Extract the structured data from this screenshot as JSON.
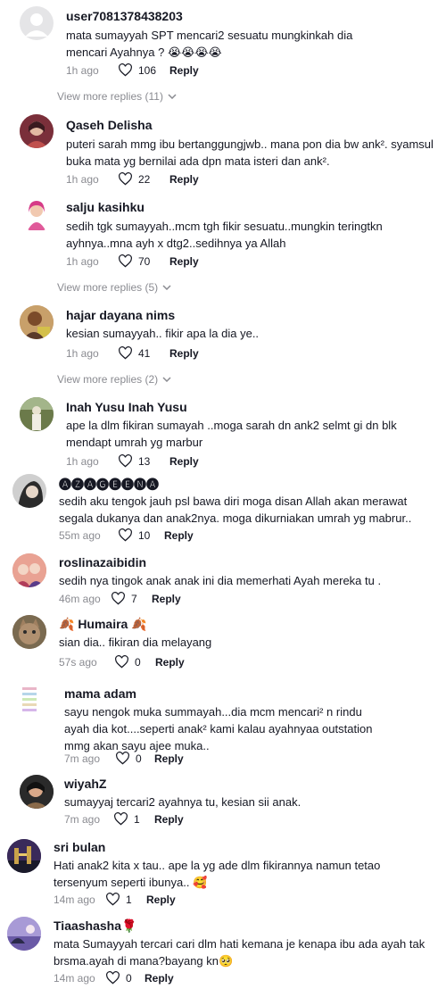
{
  "comments": [
    {
      "name": "user7081378438203",
      "text": "mata sumayyah SPT mencari2 sesuatu mungkinkah dia mencari Ayahnya ? 😭😭😭😭",
      "time": "1h ago",
      "likes": "106",
      "reply": "Reply",
      "more": "View more replies (11)"
    },
    {
      "name": "Qaseh Delisha",
      "text": "puteri sarah mmg ibu bertanggungjwb.. mana pon dia bw ank². syamsul buka mata yg bernilai ada dpn mata isteri dan ank².",
      "time": "1h ago",
      "likes": "22",
      "reply": "Reply"
    },
    {
      "name": "salju kasihku",
      "text": "sedih tgk sumayyah..mcm tgh fikir sesuatu..mungkin teringtkn ayhnya..mna ayh x dtg2..sedihnya ya Allah",
      "time": "1h ago",
      "likes": "70",
      "reply": "Reply",
      "more": "View more replies (5)"
    },
    {
      "name": "hajar dayana nims",
      "text": "kesian sumayyah.. fikir apa la dia ye..",
      "time": "1h ago",
      "likes": "41",
      "reply": "Reply",
      "more": "View more replies (2)"
    },
    {
      "name": "Inah Yusu Inah Yusu",
      "text": "ape la dlm fikiran sumayah ..moga sarah dn ank2 selmt gi dn blk mendapt umrah yg marbur",
      "time": "1h ago",
      "likes": "13",
      "reply": "Reply"
    },
    {
      "name": "🅐🅩🅐🅖🅔🅔🅝🅐",
      "text": "sedih aku tengok jauh psl bawa diri moga disan Allah akan merawat segala dukanya dan anak2nya. moga dikurniakan umrah yg mabrur..",
      "time": "55m ago",
      "likes": "10",
      "reply": "Reply"
    },
    {
      "name": "roslinazaibidin",
      "text": "sedih nya tingok anak anak ini dia memerhati Ayah mereka tu .",
      "time": "46m ago",
      "likes": "7",
      "reply": "Reply"
    },
    {
      "name": "🍂 Humaira 🍂",
      "text": "sian dia.. fikiran dia melayang",
      "time": "57s ago",
      "likes": "0",
      "reply": "Reply"
    },
    {
      "name": "mama adam",
      "text": "sayu nengok muka summayah...dia mcm mencari² n rindu ayah dia kot....seperti anak² kami kalau ayahnyaa outstation mmg akan sayu ajee muka..",
      "time": "7m ago",
      "likes": "0",
      "reply": "Reply"
    },
    {
      "name": "wiyahZ",
      "text": "sumayyaj tercari2 ayahnya tu, kesian sii anak.",
      "time": "7m ago",
      "likes": "1",
      "reply": "Reply"
    },
    {
      "name": "sri bulan",
      "text": "Hati anak2 kita x tau.. ape la yg ade dlm fikirannya namun tetao tersenyum seperti ibunya.. 🥰",
      "time": "14m ago",
      "likes": "1",
      "reply": "Reply"
    },
    {
      "name": "Tiaashasha🌹",
      "text": "mata Sumayyah tercari cari dlm hati kemana je kenapa ibu ada ayah tak brsma.ayah di mana?bayang kn🥺",
      "time": "14m ago",
      "likes": "0",
      "reply": "Reply"
    }
  ]
}
